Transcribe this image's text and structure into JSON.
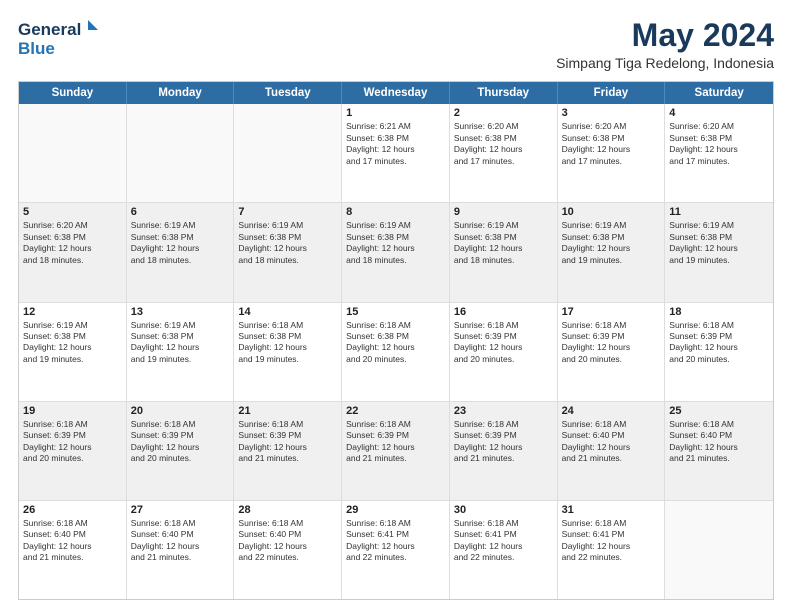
{
  "logo": {
    "line1": "General",
    "line2": "Blue"
  },
  "title": "May 2024",
  "subtitle": "Simpang Tiga Redelong, Indonesia",
  "header": {
    "days": [
      "Sunday",
      "Monday",
      "Tuesday",
      "Wednesday",
      "Thursday",
      "Friday",
      "Saturday"
    ]
  },
  "rows": [
    [
      {
        "day": "",
        "info": ""
      },
      {
        "day": "",
        "info": ""
      },
      {
        "day": "",
        "info": ""
      },
      {
        "day": "1",
        "info": "Sunrise: 6:21 AM\nSunset: 6:38 PM\nDaylight: 12 hours\nand 17 minutes."
      },
      {
        "day": "2",
        "info": "Sunrise: 6:20 AM\nSunset: 6:38 PM\nDaylight: 12 hours\nand 17 minutes."
      },
      {
        "day": "3",
        "info": "Sunrise: 6:20 AM\nSunset: 6:38 PM\nDaylight: 12 hours\nand 17 minutes."
      },
      {
        "day": "4",
        "info": "Sunrise: 6:20 AM\nSunset: 6:38 PM\nDaylight: 12 hours\nand 17 minutes."
      }
    ],
    [
      {
        "day": "5",
        "info": "Sunrise: 6:20 AM\nSunset: 6:38 PM\nDaylight: 12 hours\nand 18 minutes."
      },
      {
        "day": "6",
        "info": "Sunrise: 6:19 AM\nSunset: 6:38 PM\nDaylight: 12 hours\nand 18 minutes."
      },
      {
        "day": "7",
        "info": "Sunrise: 6:19 AM\nSunset: 6:38 PM\nDaylight: 12 hours\nand 18 minutes."
      },
      {
        "day": "8",
        "info": "Sunrise: 6:19 AM\nSunset: 6:38 PM\nDaylight: 12 hours\nand 18 minutes."
      },
      {
        "day": "9",
        "info": "Sunrise: 6:19 AM\nSunset: 6:38 PM\nDaylight: 12 hours\nand 18 minutes."
      },
      {
        "day": "10",
        "info": "Sunrise: 6:19 AM\nSunset: 6:38 PM\nDaylight: 12 hours\nand 19 minutes."
      },
      {
        "day": "11",
        "info": "Sunrise: 6:19 AM\nSunset: 6:38 PM\nDaylight: 12 hours\nand 19 minutes."
      }
    ],
    [
      {
        "day": "12",
        "info": "Sunrise: 6:19 AM\nSunset: 6:38 PM\nDaylight: 12 hours\nand 19 minutes."
      },
      {
        "day": "13",
        "info": "Sunrise: 6:19 AM\nSunset: 6:38 PM\nDaylight: 12 hours\nand 19 minutes."
      },
      {
        "day": "14",
        "info": "Sunrise: 6:18 AM\nSunset: 6:38 PM\nDaylight: 12 hours\nand 19 minutes."
      },
      {
        "day": "15",
        "info": "Sunrise: 6:18 AM\nSunset: 6:38 PM\nDaylight: 12 hours\nand 20 minutes."
      },
      {
        "day": "16",
        "info": "Sunrise: 6:18 AM\nSunset: 6:39 PM\nDaylight: 12 hours\nand 20 minutes."
      },
      {
        "day": "17",
        "info": "Sunrise: 6:18 AM\nSunset: 6:39 PM\nDaylight: 12 hours\nand 20 minutes."
      },
      {
        "day": "18",
        "info": "Sunrise: 6:18 AM\nSunset: 6:39 PM\nDaylight: 12 hours\nand 20 minutes."
      }
    ],
    [
      {
        "day": "19",
        "info": "Sunrise: 6:18 AM\nSunset: 6:39 PM\nDaylight: 12 hours\nand 20 minutes."
      },
      {
        "day": "20",
        "info": "Sunrise: 6:18 AM\nSunset: 6:39 PM\nDaylight: 12 hours\nand 20 minutes."
      },
      {
        "day": "21",
        "info": "Sunrise: 6:18 AM\nSunset: 6:39 PM\nDaylight: 12 hours\nand 21 minutes."
      },
      {
        "day": "22",
        "info": "Sunrise: 6:18 AM\nSunset: 6:39 PM\nDaylight: 12 hours\nand 21 minutes."
      },
      {
        "day": "23",
        "info": "Sunrise: 6:18 AM\nSunset: 6:39 PM\nDaylight: 12 hours\nand 21 minutes."
      },
      {
        "day": "24",
        "info": "Sunrise: 6:18 AM\nSunset: 6:40 PM\nDaylight: 12 hours\nand 21 minutes."
      },
      {
        "day": "25",
        "info": "Sunrise: 6:18 AM\nSunset: 6:40 PM\nDaylight: 12 hours\nand 21 minutes."
      }
    ],
    [
      {
        "day": "26",
        "info": "Sunrise: 6:18 AM\nSunset: 6:40 PM\nDaylight: 12 hours\nand 21 minutes."
      },
      {
        "day": "27",
        "info": "Sunrise: 6:18 AM\nSunset: 6:40 PM\nDaylight: 12 hours\nand 21 minutes."
      },
      {
        "day": "28",
        "info": "Sunrise: 6:18 AM\nSunset: 6:40 PM\nDaylight: 12 hours\nand 22 minutes."
      },
      {
        "day": "29",
        "info": "Sunrise: 6:18 AM\nSunset: 6:41 PM\nDaylight: 12 hours\nand 22 minutes."
      },
      {
        "day": "30",
        "info": "Sunrise: 6:18 AM\nSunset: 6:41 PM\nDaylight: 12 hours\nand 22 minutes."
      },
      {
        "day": "31",
        "info": "Sunrise: 6:18 AM\nSunset: 6:41 PM\nDaylight: 12 hours\nand 22 minutes."
      },
      {
        "day": "",
        "info": ""
      }
    ]
  ]
}
